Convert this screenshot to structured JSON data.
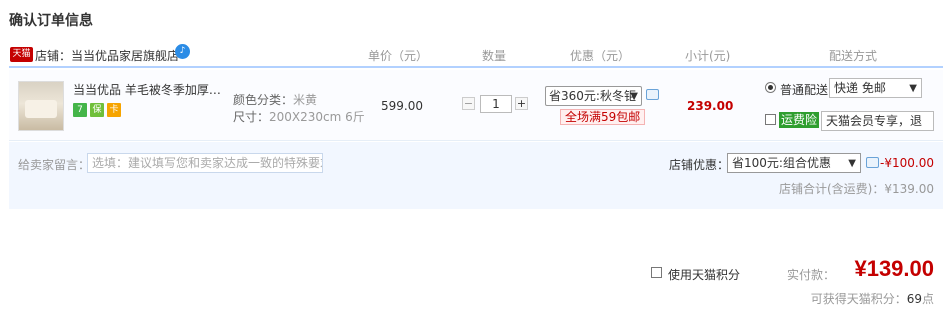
{
  "page_title": "确认订单信息",
  "header": {
    "shop_badge": "天猫",
    "shop_label": "店铺：当当优品家居旗舰店",
    "columns": {
      "unit_price": "单价（元）",
      "quantity": "数量",
      "discount": "优惠（元）",
      "subtotal": "小计(元)",
      "shipping": "配送方式"
    }
  },
  "item": {
    "name": "当当优品 羊毛被冬季加厚纯...",
    "tags": [
      "7",
      "保",
      "卡"
    ],
    "sku": {
      "color_label": "颜色分类：",
      "color_value": "米黄",
      "size_label": "尺寸：",
      "size_value": "200X230cm 6斤"
    },
    "unit_price": "599.00",
    "quantity": "1",
    "qty_minus": "−",
    "qty_plus": "+",
    "promo_selected": "省360元:秋冬钜",
    "promo_tag": "全场满59包邮",
    "subtotal": "239.00",
    "shipping": {
      "standard_label": "普通配送",
      "standard_selected": "快递 免邮",
      "insurance_badge": "运费险",
      "insurance_selected": "天猫会员专享，退"
    }
  },
  "message": {
    "label": "给卖家留言：",
    "placeholder": "选填：建议填写您和卖家达成一致的特殊要求"
  },
  "shop_discount": {
    "label": "店铺优惠：",
    "selected": "省100元:组合优惠",
    "amount": "-¥100.00",
    "shop_total": "店铺合计(含运费)：¥139.00"
  },
  "footer": {
    "tmall_points_label": "使用天猫积分",
    "pay_label": "实付款：",
    "pay_amount": "¥139.00",
    "points_text_prefix": "可获得天猫积分：",
    "points_value": "69",
    "points_unit": "点"
  },
  "colors": {
    "accent_red": "#c40000",
    "header_border": "#b2d1ff",
    "row_bg": "#fbfcff",
    "message_bg": "#f2f7ff"
  }
}
